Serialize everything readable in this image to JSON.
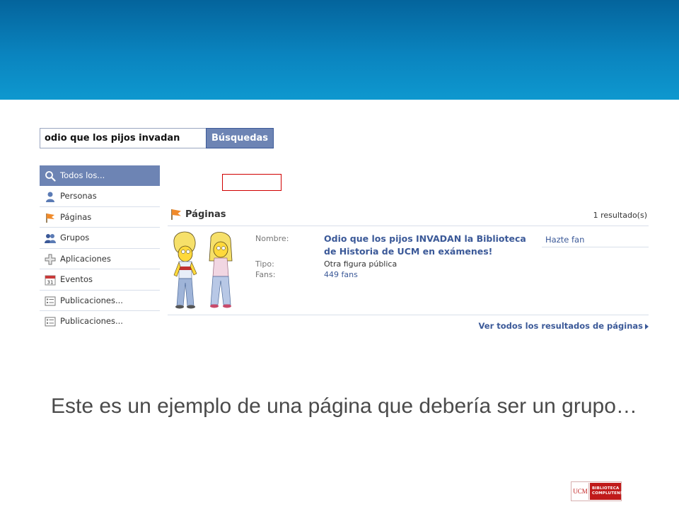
{
  "search": {
    "query": "odio que los pijos invadan",
    "button_label": "Búsquedas"
  },
  "sidebar": {
    "items": [
      {
        "label": "Todos los...",
        "icon": "search-icon"
      },
      {
        "label": "Personas",
        "icon": "person-icon"
      },
      {
        "label": "Páginas",
        "icon": "pages-flag-icon"
      },
      {
        "label": "Grupos",
        "icon": "groups-icon"
      },
      {
        "label": "Aplicaciones",
        "icon": "applications-icon"
      },
      {
        "label": "Eventos",
        "icon": "calendar-icon"
      },
      {
        "label": "Publicaciones...",
        "icon": "posts-icon"
      },
      {
        "label": "Publicaciones...",
        "icon": "posts-icon"
      }
    ]
  },
  "results": {
    "title": "Páginas",
    "count": "1 resultado(s)",
    "item": {
      "name_label": "Nombre:",
      "name": "Odio que los pijos INVADAN la Biblioteca de Historia de UCM en exámenes!",
      "type_label": "Tipo:",
      "type": "Otra figura pública",
      "fans_label": "Fans:",
      "fans": "449 fans",
      "action": "Hazte fan"
    },
    "see_all": "Ver todos los resultados de páginas"
  },
  "caption": "Este es un ejemplo de una página que debería ser un grupo…",
  "logo": {
    "mark": "UCM",
    "line1": "BIBLIOTECA",
    "line2": "COMPLUTENSE"
  },
  "colors": {
    "banner": "#0a84bf",
    "accent": "#3b5998",
    "active_item": "#6d84b4",
    "highlight_box": "#d00000"
  }
}
